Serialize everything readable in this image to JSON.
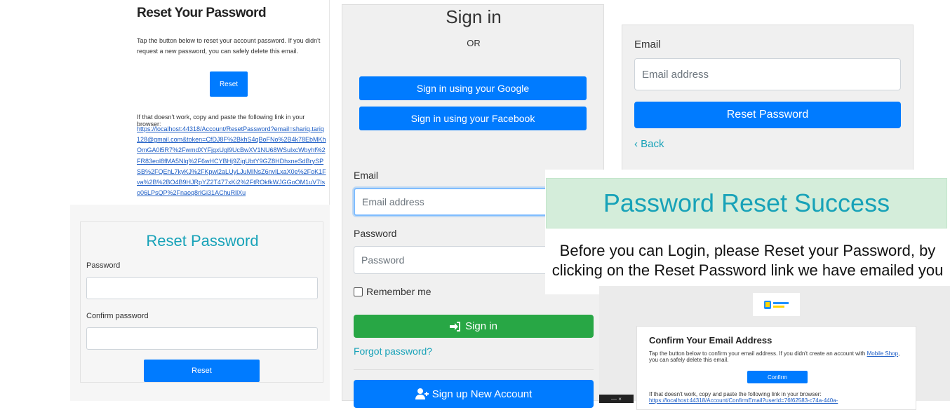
{
  "reset_email": {
    "title": "Reset Your Password",
    "message": "Tap the button below to reset your account password. If you didn't request a new password, you can safely delete this email.",
    "button": "Reset",
    "fallback": "If that doesn't work, copy and paste the following link in your browser:",
    "link": "https://localhost:44318/Account/ResetPassword?email=shariq.tariq128@gmail.com&token=CfDJ8F%2BkhS4qBoFNo%2B4k78EbMKhOmGA0l5R7%2FwmdXYFjgxUgl9UcBwXV1NU68WSulxcWbyhf%2FR83eol8fMA5Nlq%2F6wHCYBHj9ZigUbtY9GZ8HDhxneSdBrySPSB%2FQEhL7kyKJ%2FKpwl2aLUyLJuMlNsZ6nvlLxaX0e%2FoK1Fva%2B%2BO4B9HJRpYZ2T477xKi2%2FtROkfkWJGGoOM1uV7Iso06LPsQP%2Fnaoq8rlGi31AChuRllXu"
  },
  "reset_form": {
    "heading": "Reset Password",
    "password_label": "Password",
    "confirm_label": "Confirm password",
    "button": "Reset"
  },
  "signin": {
    "title": "Sign in",
    "or": "OR",
    "google": "Sign in using your Google",
    "facebook": "Sign in using your Facebook",
    "email_label": "Email",
    "email_placeholder": "Email address",
    "password_label": "Password",
    "password_placeholder": "Password",
    "remember": "Remember me",
    "signin_button": "Sign in",
    "forgot": "Forgot password?",
    "signup_button": "Sign up New Account"
  },
  "forgot": {
    "email_label": "Email",
    "email_placeholder": "Email address",
    "button": "Reset Password",
    "back": "Back"
  },
  "success": {
    "heading": "Password Reset Success",
    "body": "Before you can Login, please Reset your Password, by clicking on the Reset Password link we have emailed you"
  },
  "confirm_email": {
    "heading": "Confirm Your Email Address",
    "message_pre": "Tap the button below to confirm your email address. If you didn't create an account with",
    "message_link": "Mobile Shop",
    "message_post": ", you can safely delete this email.",
    "button": "Confirm",
    "fallback": "If that doesn't work, copy and paste the following link in your browser:",
    "link": "https://localhost:44318/Account/ConfirmEmail?userId=76f62583-c74a-440a-"
  },
  "colors": {
    "primary": "#007bff",
    "success": "#28a745",
    "info": "#17a2b8",
    "success_bg": "#d4edda"
  }
}
